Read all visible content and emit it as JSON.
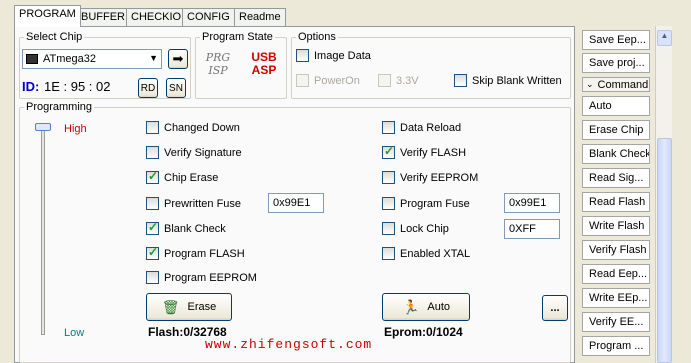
{
  "tabs": [
    "PROGRAM",
    "BUFFER",
    "CHECKIO",
    "CONFIG",
    "Readme"
  ],
  "select_chip": {
    "legend": "Select Chip",
    "chip": "ATmega32",
    "id_label": "ID:",
    "id_value": "1E : 95 : 02",
    "rd": "RD",
    "sn": "SN"
  },
  "program_state": {
    "legend": "Program State",
    "isp_text": "PRG ISP",
    "usbasp_text": "USB ASP"
  },
  "options": {
    "legend": "Options",
    "image_data": "Image Data",
    "poweron": "PowerOn",
    "v33": "3.3V",
    "skip_blank": "Skip Blank Written"
  },
  "programming": {
    "legend": "Programming",
    "high": "High",
    "low": "Low",
    "left_items": [
      {
        "label": "Changed Down",
        "checked": false
      },
      {
        "label": "Verify Signature",
        "checked": false
      },
      {
        "label": "Chip Erase",
        "checked": true
      },
      {
        "label": "Prewritten Fuse",
        "checked": false
      },
      {
        "label": "Blank Check",
        "checked": true
      },
      {
        "label": "Program FLASH",
        "checked": true
      },
      {
        "label": "Program EEPROM",
        "checked": false
      }
    ],
    "right_items": [
      {
        "label": "Data Reload",
        "checked": false
      },
      {
        "label": "Verify FLASH",
        "checked": true
      },
      {
        "label": "Verify EEPROM",
        "checked": false
      },
      {
        "label": "Program Fuse",
        "checked": false
      },
      {
        "label": "Lock Chip",
        "checked": false
      },
      {
        "label": "Enabled XTAL",
        "checked": false
      }
    ],
    "prewritten_fuse_value": "0x99E1",
    "program_fuse_value": "0x99E1",
    "lock_chip_value": "0XFF",
    "erase_label": "Erase",
    "auto_label": "Auto",
    "more_label": "...",
    "flash_status": "Flash:0/32768",
    "eprom_status": "Eprom:0/1024"
  },
  "watermark": "www.zhifengsoft.com",
  "sidebar": {
    "top_items": [
      "Save Eep...",
      "Save proj..."
    ],
    "command_header": "Command",
    "items": [
      "Auto",
      "Erase Chip",
      "Blank Check",
      "Read Sig...",
      "Read Flash",
      "Write Flash",
      "Verify Flash",
      "Read Eep...",
      "Write EEp...",
      "Verify EE...",
      "Program ..."
    ]
  },
  "colors": {
    "high": "#cc0000",
    "low": "#008080",
    "id": "#0000cc",
    "watermark": "#cc0000"
  }
}
